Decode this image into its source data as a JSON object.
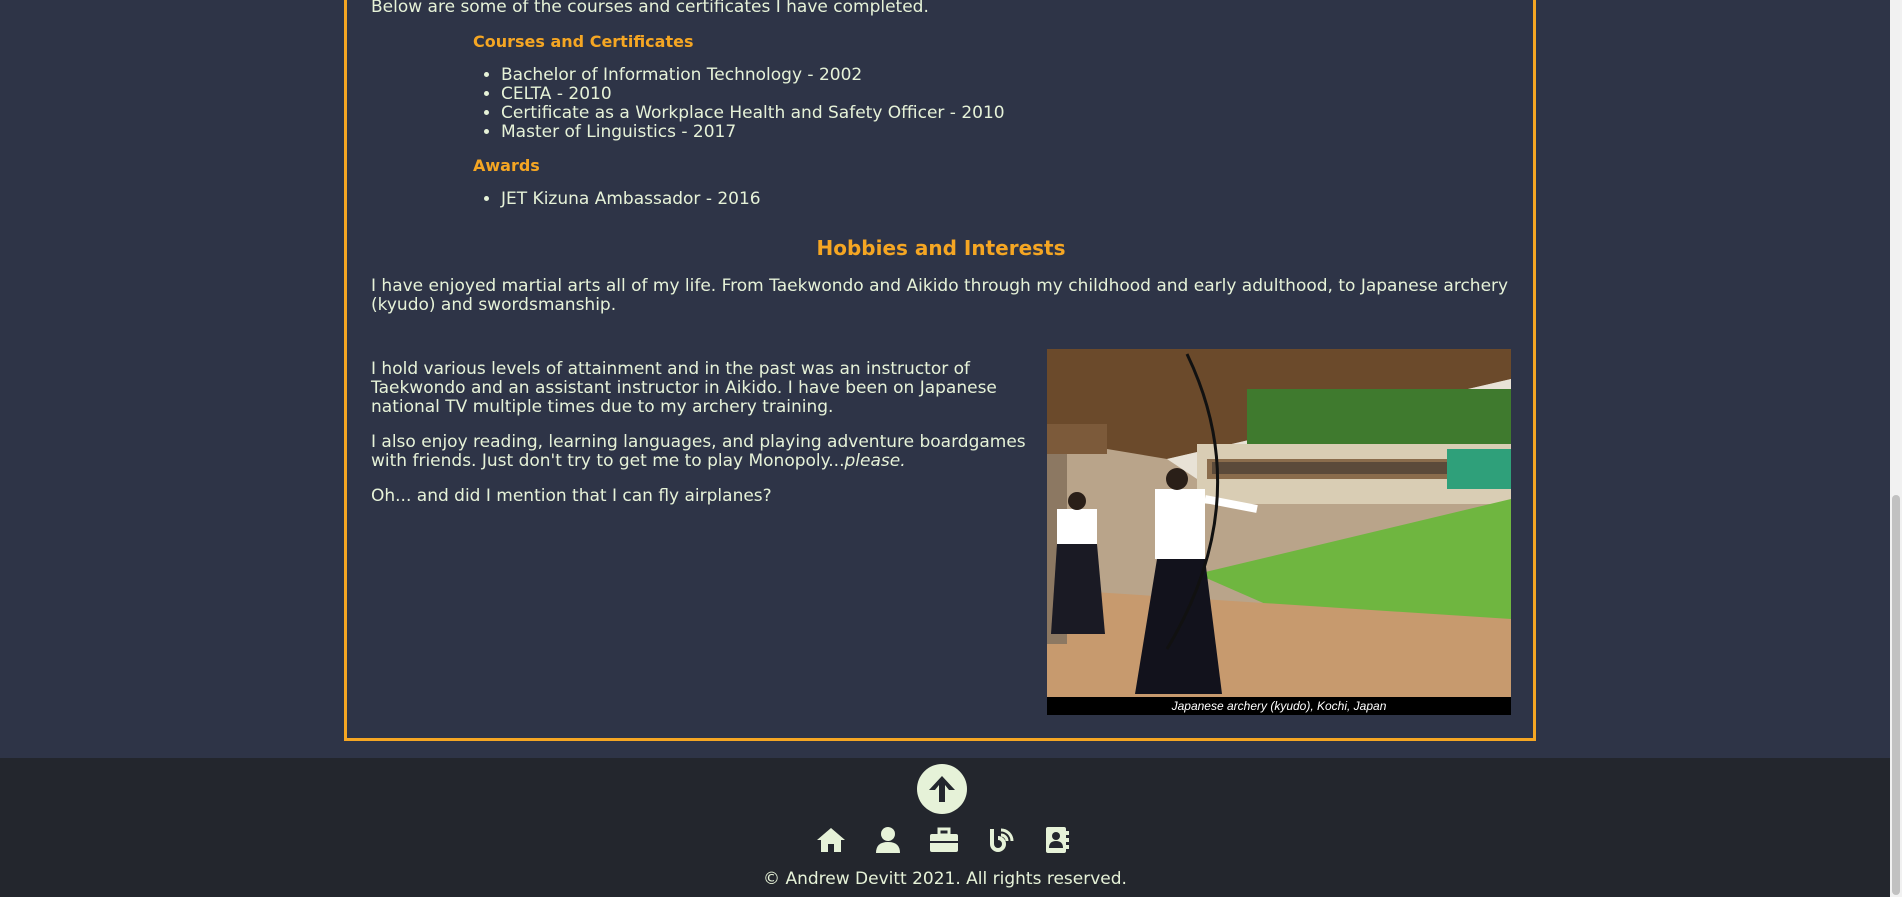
{
  "intro": "Below are some of the courses and certificates I have completed.",
  "courses": {
    "heading": "Courses and Certificates",
    "items": [
      "Bachelor of Information Technology - 2002",
      "CELTA - 2010",
      "Certificate as a Workplace Health and Safety Officer - 2010",
      "Master of Linguistics - 2017"
    ]
  },
  "awards": {
    "heading": "Awards",
    "items": [
      "JET Kizuna Ambassador - 2016"
    ]
  },
  "hobbies": {
    "title": "Hobbies and Interests",
    "p1": "I have enjoyed martial arts all of my life. From Taekwondo and Aikido through my childhood and early adulthood, to Japanese archery (kyudo) and swordsmanship.",
    "p2": "I hold various levels of attainment and in the past was an instructor of Taekwondo and an assistant instructor in Aikido. I have been on Japanese national TV multiple times due to my archery training.",
    "p3_main": "I also enjoy reading, learning languages, and playing adventure boardgames with friends. Just don't try to get me to play Monopoly...",
    "p3_em": "please.",
    "p4": "Oh... and did I mention that I can fly airplanes?",
    "photo_caption": "Japanese archery (kyudo), Kochi, Japan"
  },
  "footer": {
    "back_to_top_icon": "arrow-up-circle-icon",
    "nav_icons": [
      "home-icon",
      "user-icon",
      "briefcase-icon",
      "blog-icon",
      "contact-book-icon"
    ],
    "copyright": "© Andrew Devitt 2021. All rights reserved."
  },
  "colors": {
    "background": "#2e3447",
    "accent": "#f5a623",
    "text": "#e6f2d8",
    "footer": "#23262d"
  }
}
